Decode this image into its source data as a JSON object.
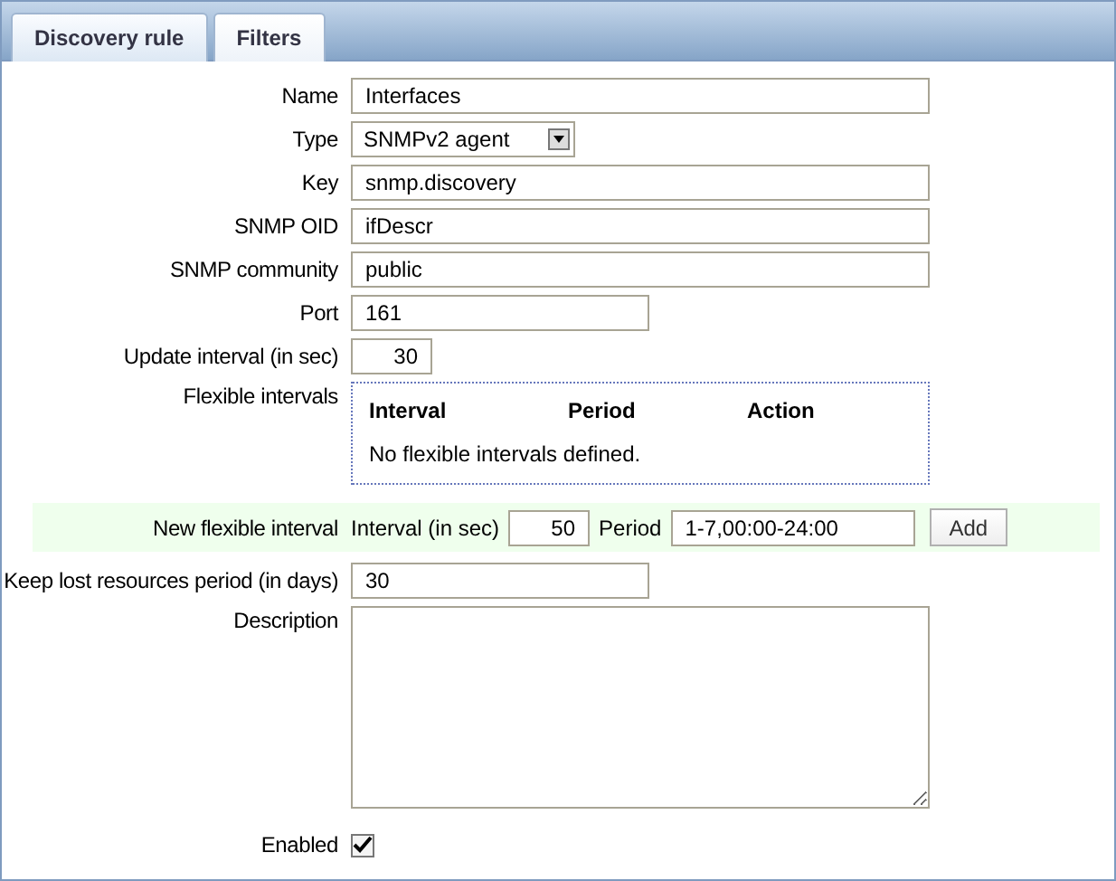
{
  "tabs": [
    {
      "label": "Discovery rule",
      "selected": true
    },
    {
      "label": "Filters",
      "selected": false
    }
  ],
  "fields": [
    {
      "kind": "text",
      "label": "Name",
      "value": "Interfaces"
    },
    {
      "kind": "select",
      "label": "Type",
      "value": "SNMPv2 agent"
    },
    {
      "kind": "text",
      "label": "Key",
      "value": "snmp.discovery"
    },
    {
      "kind": "text",
      "label": "SNMP OID",
      "value": "ifDescr"
    },
    {
      "kind": "text",
      "label": "SNMP community",
      "value": "public"
    },
    {
      "kind": "short",
      "label": "Port",
      "value": "161"
    },
    {
      "kind": "number",
      "label": "Update interval (in sec)",
      "value": "30"
    },
    {
      "kind": "intervals",
      "label": "Flexible intervals",
      "columns": [
        "Interval",
        "Period",
        "Action"
      ],
      "empty": "No flexible intervals defined."
    },
    {
      "kind": "new_interval",
      "label": "New flexible interval",
      "interval_label": "Interval (in sec)",
      "interval_value": "50",
      "period_label": "Period",
      "period_value": "1-7,00:00-24:00",
      "button": "Add"
    },
    {
      "kind": "short",
      "label": "Keep lost resources period (in days)",
      "value": "30"
    },
    {
      "kind": "textarea",
      "label": "Description"
    },
    {
      "kind": "checkbox",
      "label": "Enabled",
      "checked": true
    }
  ]
}
